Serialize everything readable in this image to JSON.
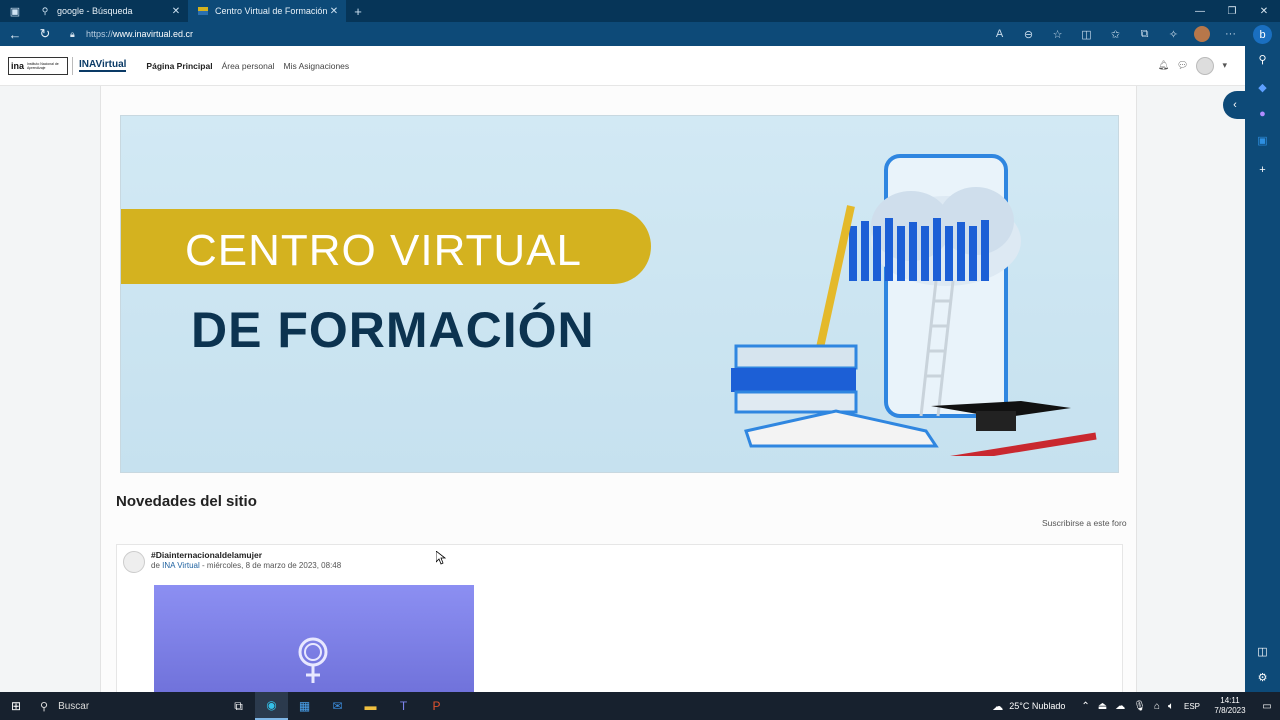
{
  "browser": {
    "tabs": [
      {
        "label": "google - Búsqueda",
        "icon": "search-icon"
      },
      {
        "label": "Centro Virtual de Formación - Ina",
        "icon": "ina-favicon"
      }
    ],
    "url_proto": "https://",
    "url_host": "www.inavirtual.ed.cr"
  },
  "site": {
    "logo_ina": "ina",
    "logo_ina_sub": "Instituto Nacional de Aprendizaje",
    "logo_inav": "INAVirtual",
    "menu": [
      "Página Principal",
      "Área personal",
      "Mis Asignaciones"
    ]
  },
  "banner": {
    "line1": "CENTRO VIRTUAL",
    "line2": "DE FORMACIÓN"
  },
  "news": {
    "title": "Novedades del sitio",
    "subscribe": "Suscribirse a este foro",
    "post": {
      "subject": "#Diainternacionaldelamujer",
      "prefix": "de ",
      "author": "INA Virtual",
      "date": " - miércoles, 8 de marzo de 2023, 08:48"
    }
  },
  "taskbar": {
    "search": "Buscar",
    "weather": "25°C  Nublado",
    "lang": "ESP",
    "time": "14:11",
    "date": "7/8/2023"
  },
  "colors": {
    "accent": "#0d4a78",
    "banner_pill": "#d4b21f",
    "banner_text_dark": "#0c3350"
  }
}
